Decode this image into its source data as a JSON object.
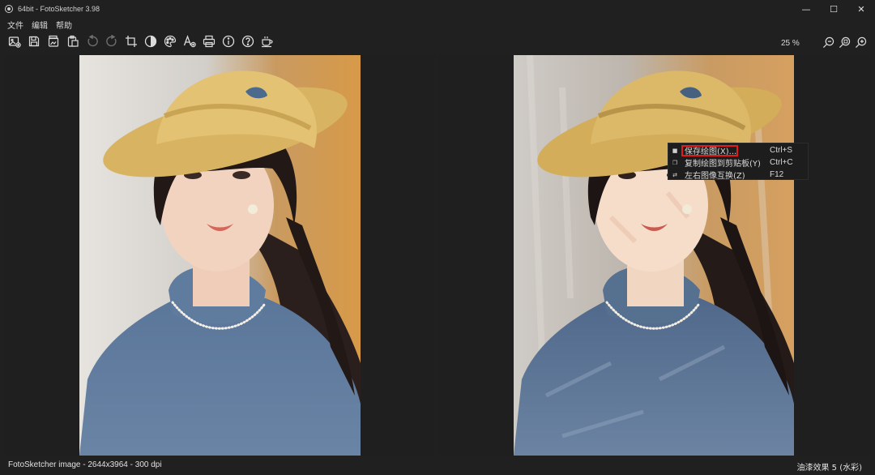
{
  "window": {
    "title": "64bit - FotoSketcher 3.98",
    "controls": {
      "minimize": "—",
      "maximize": "☐",
      "close": "✕"
    }
  },
  "menu": [
    "文件",
    "编辑",
    "帮助"
  ],
  "toolbar": [
    {
      "name": "new-open-icon"
    },
    {
      "name": "save-icon"
    },
    {
      "name": "copy-image-icon"
    },
    {
      "name": "paste-icon"
    },
    {
      "name": "undo-icon"
    },
    {
      "name": "redo-icon"
    },
    {
      "name": "crop-icon"
    },
    {
      "name": "contrast-icon"
    },
    {
      "name": "palette-icon"
    },
    {
      "name": "add-text-icon"
    },
    {
      "name": "print-icon"
    },
    {
      "name": "info-icon"
    },
    {
      "name": "help-icon"
    },
    {
      "name": "coffee-icon"
    }
  ],
  "zoom": {
    "level": "25 %",
    "buttons": [
      "zoom-out-icon",
      "zoom-fit-icon",
      "zoom-in-icon"
    ]
  },
  "context_menu": {
    "items": [
      {
        "label": "保存绘图(X)...",
        "shortcut": "Ctrl+S",
        "icon": "save-icon",
        "highlighted": true
      },
      {
        "label": "复制绘图到剪贴板(Y)",
        "shortcut": "Ctrl+C",
        "icon": "copy-icon",
        "highlighted": false
      },
      {
        "label": "左右图像互换(Z)",
        "shortcut": "F12",
        "icon": "swap-icon",
        "highlighted": false
      }
    ]
  },
  "status": {
    "left": "FotoSketcher image - 2644x3964 - 300 dpi",
    "right": "油漆效果 5 (水彩)"
  },
  "colors": {
    "background": "#202020",
    "panel": "#1f1f1f",
    "highlight": "#e01c1c",
    "text": "#e6e6e6"
  }
}
